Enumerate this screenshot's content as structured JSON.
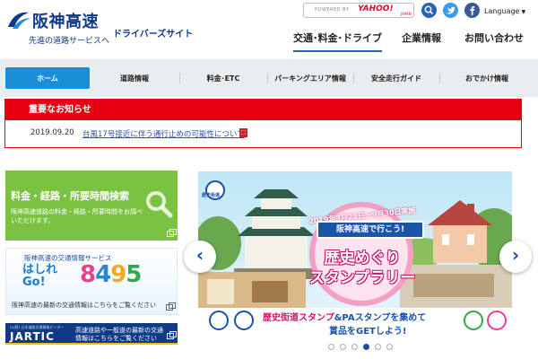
{
  "header": {
    "logo_name": "阪神高速",
    "logo_sub": "ドライバーズサイト",
    "logo_tagline": "先進の道路サービスへ",
    "search_powered": "POWERED BY",
    "search_brand": "YAHOO!",
    "search_brand_sub": "JAPAN",
    "language_label": "Language",
    "global_nav": [
      "交通･料金･ドライブ",
      "企業情報",
      "お問い合わせ"
    ]
  },
  "subnav": {
    "tabs": [
      "ホーム",
      "道路情報",
      "料金･ETC",
      "パーキングエリア情報",
      "安全走行ガイド",
      "おでかけ情報"
    ],
    "active_index": 0
  },
  "notice": {
    "heading": "重要なお知らせ",
    "date": "2019.09.20",
    "link_text": "台風17号接近に伴う通行止めの可能性について",
    "file_type": "pdf"
  },
  "cards": {
    "fares": {
      "title": "料金・経路・所要時間検索",
      "desc": "阪神高速道路の料金・経路・所要時間をお調べいただけます。"
    },
    "hashire": {
      "sub": "阪神高速の交通情報サービス",
      "name": "はしれGo!",
      "num": [
        "8",
        "4",
        "9",
        "5"
      ],
      "desc": "阪神高速の最新の交通情報はこちらをご覧ください"
    },
    "jartic": {
      "small": "(公財) 日本道路交通情報センター",
      "name": "JARTIC",
      "desc": "高速道路や一般道の最新の交通情報はこちらをご覧ください"
    }
  },
  "carousel": {
    "badge": "歴史街道",
    "date_text": "2019年3月21日～9月30日実施",
    "headline": "阪神高速で行こう!",
    "title_line1": "歴史めぐり",
    "title_line2": "スタンプラリー",
    "bottom_line1_a": "歴史街道スタンプ",
    "bottom_line1_b": "&PAスタンプを集めて",
    "bottom_line2": "賞品をGETしよう!",
    "prev_symbol": "‹",
    "next_symbol": "›",
    "slide_count": 6,
    "active_slide": 3
  },
  "colors": {
    "brand_blue": "#0b3a8c",
    "tab_active": "#1a8ed6",
    "notice_red": "#e60012",
    "card_green": "#7cc242",
    "jartic_navy": "#0f3a86"
  },
  "icons": [
    "search-icon",
    "twitter-icon",
    "facebook-icon",
    "globe-icon",
    "pdf-icon",
    "magnifier-icon",
    "external-link-icon",
    "chevron-left-icon",
    "chevron-right-icon"
  ]
}
